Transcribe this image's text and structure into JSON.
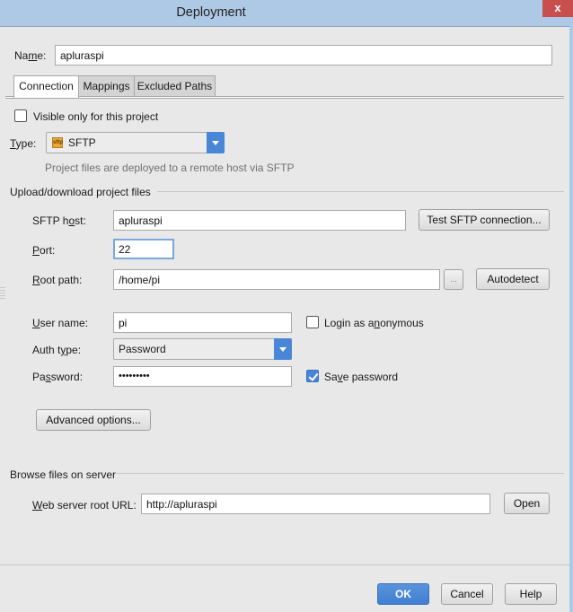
{
  "window": {
    "title": "Deployment",
    "close_label": "x"
  },
  "name_field": {
    "label_pre": "Na",
    "label_mnemonic": "m",
    "label_post": "e:",
    "value": "apluraspi"
  },
  "tabs": [
    {
      "label": "Connection",
      "active": true
    },
    {
      "label": "Mappings",
      "active": false
    },
    {
      "label": "Excluded Paths",
      "active": false
    }
  ],
  "connection": {
    "visible_only_label": "Visible only for this project",
    "visible_only_checked": false,
    "type_label_mnemonic": "T",
    "type_label_post": "ype:",
    "type_icon": "sftp-icon",
    "type_icon_text": "sftp",
    "type_value": "SFTP",
    "type_hint": "Project files are deployed to a remote host via SFTP",
    "upload_section_title": "Upload/download project files",
    "sftp_host": {
      "label_pre": "SFTP h",
      "label_mnemonic": "o",
      "label_post": "st:",
      "value": "apluraspi",
      "test_button": "Test SFTP connection..."
    },
    "port": {
      "label_mnemonic": "P",
      "label_post": "ort:",
      "value": "22"
    },
    "root_path": {
      "label_mnemonic": "R",
      "label_post": "oot path:",
      "value": "/home/pi",
      "browse_label": "...",
      "autodetect_button": "Autodetect"
    },
    "user_name": {
      "label_mnemonic": "U",
      "label_post": "ser name:",
      "value": "pi",
      "anonymous_pre": "Login as a",
      "anonymous_mnemonic": "n",
      "anonymous_post": "onymous",
      "anonymous_checked": false
    },
    "auth_type": {
      "label_pre": "Auth t",
      "label_mnemonic": "y",
      "label_post": "pe:",
      "value": "Password"
    },
    "password": {
      "label_pre": "Pa",
      "label_mnemonic": "s",
      "label_post": "sword:",
      "value": "•••••••••",
      "save_pre": "Sa",
      "save_mnemonic": "v",
      "save_post": "e password",
      "save_checked": true
    },
    "advanced_button": "Advanced options...",
    "browse_section_title": "Browse files on server",
    "web_root": {
      "label_mnemonic": "W",
      "label_post": "eb server root URL:",
      "value": "http://apluraspi",
      "open_button": "Open"
    }
  },
  "footer": {
    "ok": "OK",
    "cancel": "Cancel",
    "help": "Help"
  }
}
